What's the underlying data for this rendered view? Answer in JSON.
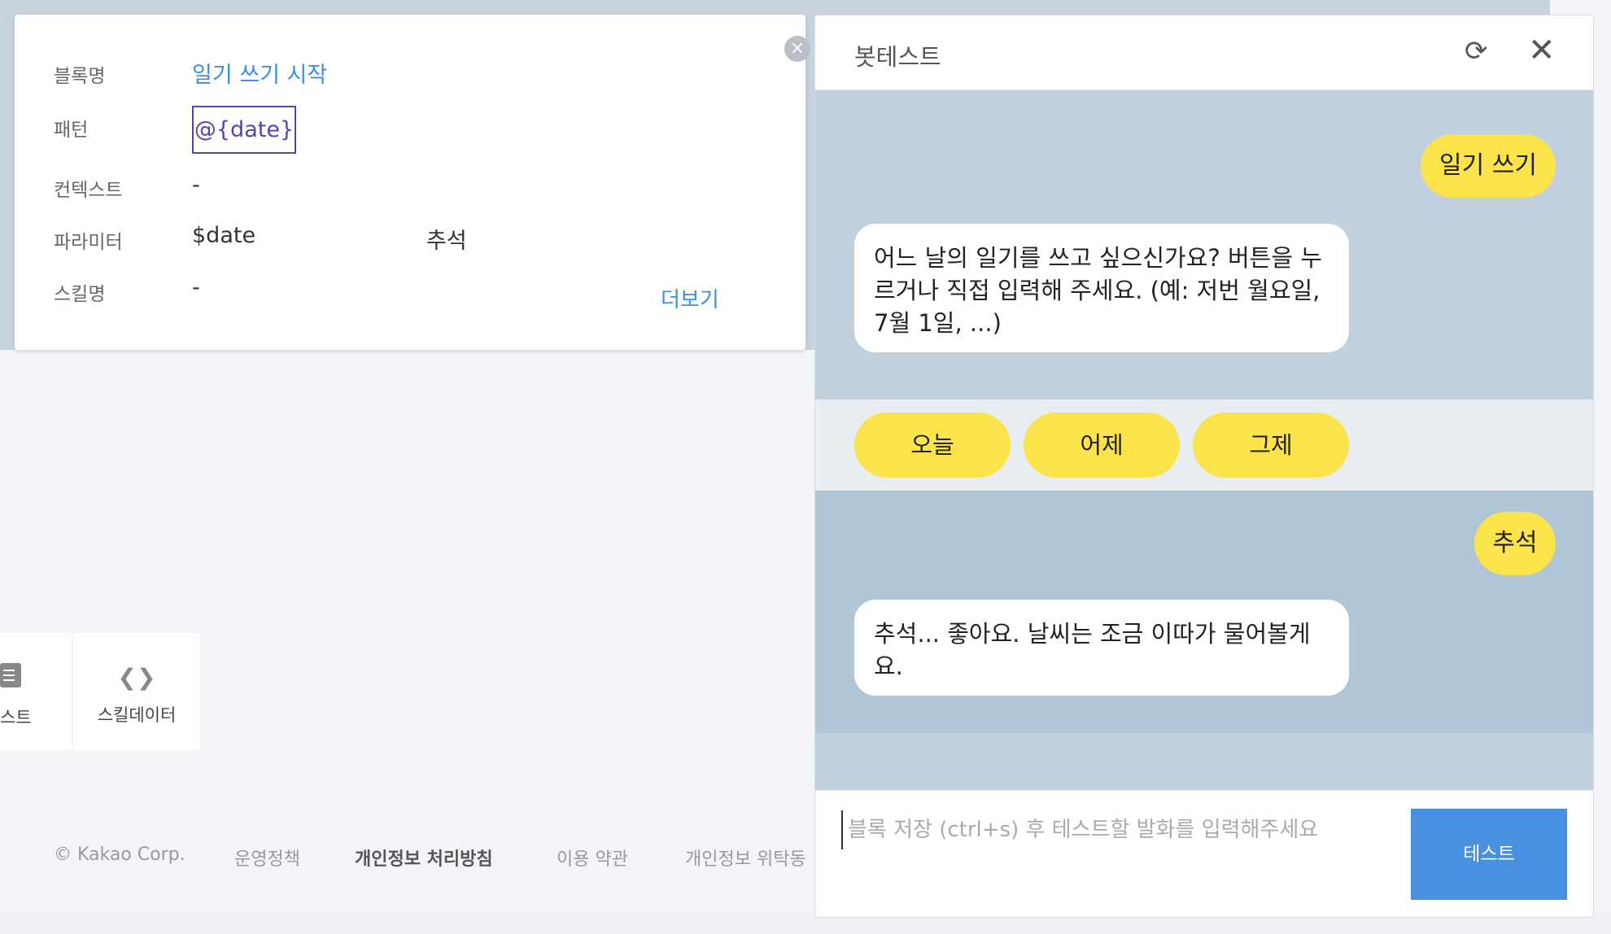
{
  "block_detail": {
    "close_icon": "close-circle-icon",
    "rows": [
      {
        "label": "블록명",
        "value": "일기 쓰기 시작"
      },
      {
        "label": "패턴",
        "value": "@{date}"
      },
      {
        "label": "컨텍스트",
        "value": "-"
      },
      {
        "label": "파라미터",
        "value": "$date",
        "extra": "추석"
      },
      {
        "label": "스킬명",
        "value": "-"
      }
    ],
    "more_link": "더보기"
  },
  "tabs": [
    {
      "label": "스트",
      "icon": "document-icon"
    },
    {
      "label": "스킬데이터",
      "icon": "code-brackets-icon"
    }
  ],
  "footer": {
    "copyright": "© Kakao Corp.",
    "links": [
      "운영정책",
      "개인정보 처리방침",
      "이용 약관",
      "개인정보 위탁동"
    ]
  },
  "bot_test": {
    "title": "봇테스트",
    "refresh_icon": "refresh-icon",
    "close_icon": "close-icon",
    "messages": [
      {
        "from": "user",
        "text": "일기 쓰기"
      },
      {
        "from": "bot",
        "text": "어느 날의 일기를 쓰고 싶으신가요? 버튼을 누르거나 직접 입력해 주세요. (예: 저번 월요일, 7월 1일, ...)"
      },
      {
        "from": "user",
        "text": "추석"
      },
      {
        "from": "bot",
        "text": "추석... 좋아요. 날씨는 조금 이따가 물어볼게요."
      }
    ],
    "quick_replies": [
      "오늘",
      "어제",
      "그제"
    ],
    "input_placeholder": "블록 저장 (ctrl+s) 후 테스트할 발화를 입력해주세요",
    "input_value": "",
    "send_label": "테스트"
  }
}
